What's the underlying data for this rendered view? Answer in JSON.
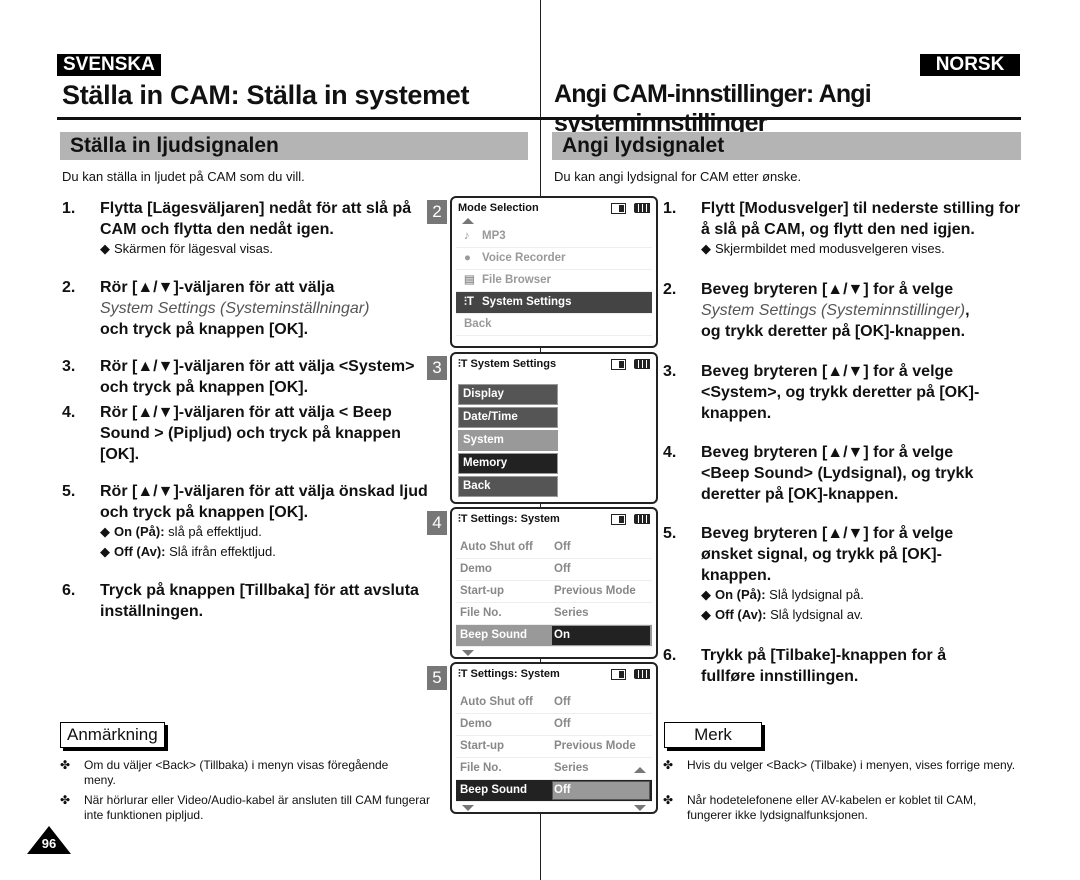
{
  "left": {
    "lang": "SVENSKA",
    "title": "Ställa in CAM: Ställa in systemet",
    "section": "Ställa in ljudsignalen",
    "intro": "Du kan ställa in ljudet på CAM som du vill.",
    "steps": [
      {
        "num": "1.",
        "text": "Flytta [Lägesväljaren] nedåt för att slå på CAM och flytta den nedåt igen."
      },
      {
        "num": "2.",
        "text_a": "Rör [▲/▼]-väljaren för att välja",
        "text_italic": "System Settings (Systeminställningar)",
        "text_b": "och tryck på knappen [OK]."
      },
      {
        "num": "3.",
        "text": "Rör [▲/▼]-väljaren för att välja <System> och tryck på knappen [OK]."
      },
      {
        "num": "4.",
        "text": "Rör [▲/▼]-väljaren för att välja < Beep Sound > (Pipljud) och tryck på knappen [OK]."
      },
      {
        "num": "5.",
        "text": "Rör [▲/▼]-väljaren för att välja önskad ljud och tryck på knappen [OK]."
      },
      {
        "num": "6.",
        "text": "Tryck på knappen [Tillbaka] för att avsluta inställningen."
      }
    ],
    "step1_sub": "Skärmen för lägesval visas.",
    "step5_subs": [
      {
        "bold": "On (På):",
        "text": " slå på effektljud."
      },
      {
        "bold": "Off (Av):",
        "text": " Slå ifrån effektljud."
      }
    ],
    "note_label": "Anmärkning",
    "notes": [
      "Om du väljer <Back> (Tillbaka) i menyn visas föregående meny.",
      "När hörlurar eller Video/Audio-kabel är ansluten till CAM fungerar inte funktionen pipljud."
    ],
    "page_number": "96"
  },
  "right": {
    "lang": "NORSK",
    "title": "Angi CAM-innstillinger: Angi systeminnstillinger",
    "section": "Angi lydsignalet",
    "intro": "Du kan angi lydsignal for CAM etter ønske.",
    "steps": [
      {
        "num": "1.",
        "text": "Flytt [Modusvelger] til nederste stilling for å slå på CAM, og flytt den ned igjen."
      },
      {
        "num": "2.",
        "text_a": "Beveg bryteren [▲/▼] for å velge",
        "text_italic": "System Settings (Systeminnstillinger)",
        "text_b": "og trykk deretter på [OK]-knappen."
      },
      {
        "num": "3.",
        "text": "Beveg bryteren [▲/▼] for å velge <System>, og trykk deretter på [OK]-knappen."
      },
      {
        "num": "4.",
        "text": "Beveg bryteren [▲/▼] for å velge <Beep Sound> (Lydsignal), og trykk deretter på [OK]-knappen."
      },
      {
        "num": "5.",
        "text": "Beveg bryteren [▲/▼] for å velge ønsket signal, og trykk på [OK]-knappen."
      },
      {
        "num": "6.",
        "text": "Trykk på [Tilbake]-knappen for å fullføre innstillingen."
      }
    ],
    "step1_sub": "Skjermbildet med modusvelgeren vises.",
    "step5_subs": [
      {
        "bold": "On (På):",
        "text": " Slå lydsignal på."
      },
      {
        "bold": "Off (Av):",
        "text": " Slå lydsignal av."
      }
    ],
    "note_label": "Merk",
    "notes": [
      "Hvis du velger <Back> (Tilbake) i menyen, vises forrige meny.",
      "Når hodetelefonene eller AV-kabelen er koblet til CAM, fungerer ikke lydsignalfunksjonen."
    ]
  },
  "screens": {
    "s2": {
      "num": "2",
      "title": "Mode Selection",
      "items": [
        {
          "icon": "♪",
          "label": "MP3"
        },
        {
          "icon": "🎙",
          "label": "Voice Recorder"
        },
        {
          "icon": "▤",
          "label": "File Browser"
        },
        {
          "icon": "⫶T",
          "label": "System Settings",
          "selected": true
        },
        {
          "icon": "",
          "label": "Back"
        }
      ]
    },
    "s3": {
      "num": "3",
      "title": "System Settings",
      "items": [
        "Display",
        "Date/Time",
        "System",
        "Memory",
        "Back"
      ]
    },
    "s4": {
      "num": "4",
      "title": "Settings: System",
      "rows": [
        {
          "key": "Auto Shut off",
          "value": "Off"
        },
        {
          "key": "Demo",
          "value": "Off"
        },
        {
          "key": "Start-up",
          "value": "Previous Mode"
        },
        {
          "key": "File No.",
          "value": "Series"
        },
        {
          "key": "Beep Sound",
          "value": "On"
        }
      ]
    },
    "s5": {
      "num": "5",
      "title": "Settings: System",
      "rows": [
        {
          "key": "Auto Shut off",
          "value": "Off"
        },
        {
          "key": "Demo",
          "value": "Off"
        },
        {
          "key": "Start-up",
          "value": "Previous Mode"
        },
        {
          "key": "File No.",
          "value": "Series"
        },
        {
          "key": "Beep Sound",
          "value": "Off"
        }
      ]
    }
  }
}
